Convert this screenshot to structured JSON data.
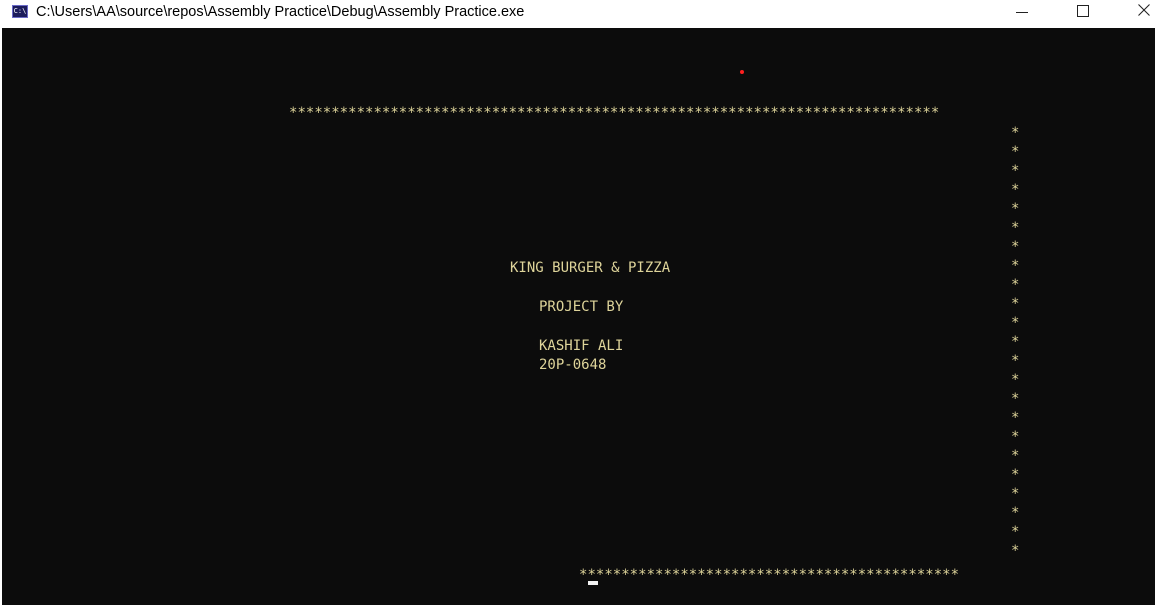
{
  "window": {
    "title": "C:\\Users\\AA\\source\\repos\\Assembly Practice\\Debug\\Assembly Practice.exe",
    "icon": "console-app-icon",
    "icon_glyph": "C:\\",
    "controls": {
      "minimize": "minimize-icon",
      "maximize": "maximize-icon",
      "close": "close-icon"
    }
  },
  "console": {
    "background_color": "#0c0c0c",
    "text_color": "#ded49a",
    "border_top": "*****************************************************************************",
    "border_bottom": "*********************************************",
    "border_right": "*\n*\n*\n*\n*\n*\n*\n*\n*\n*\n*\n*\n*\n*\n*\n*\n*\n*\n*\n*\n*\n*\n*",
    "lines": {
      "title": "KING BURGER & PIZZA",
      "project_by": "PROJECT BY",
      "author": "KASHIF ALI",
      "student_id": "20P-0648"
    }
  }
}
